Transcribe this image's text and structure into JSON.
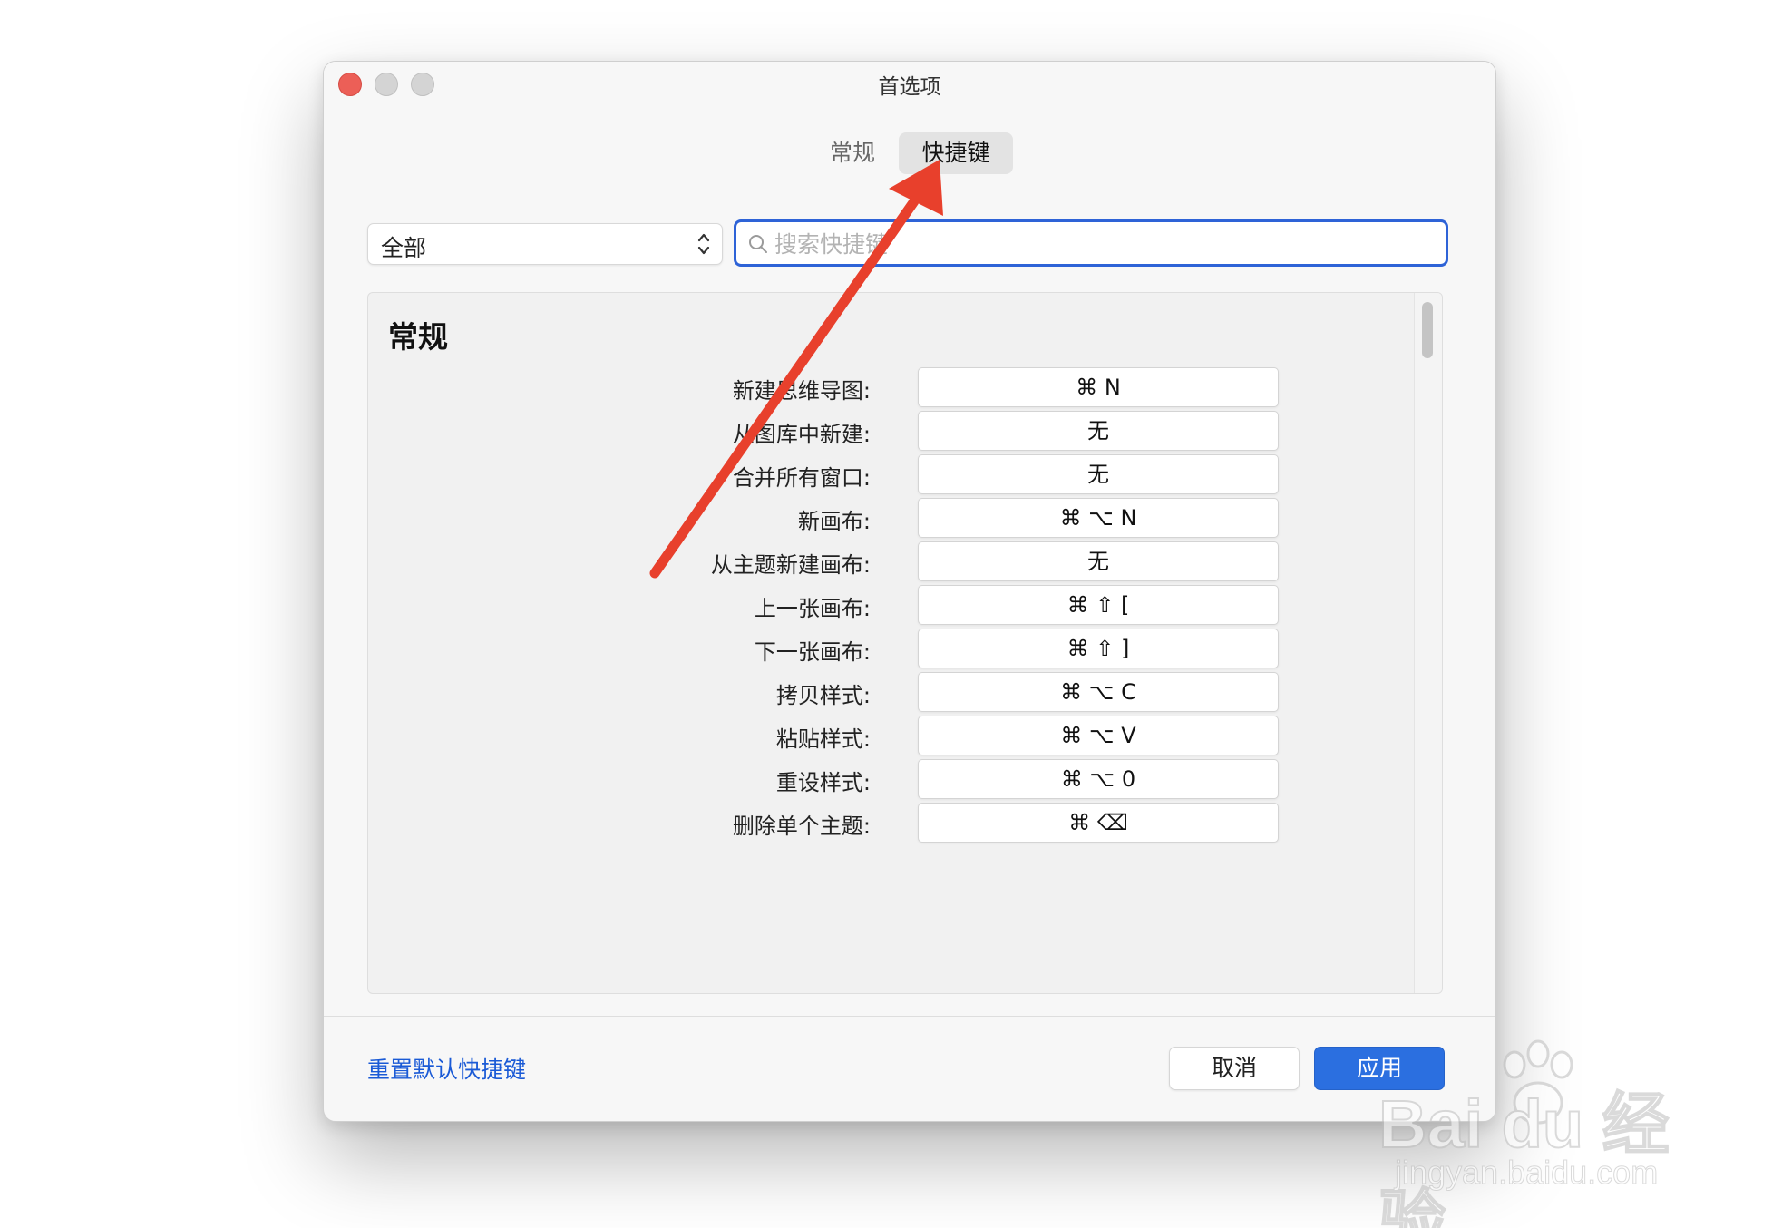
{
  "window": {
    "title": "首选项"
  },
  "tabs": [
    {
      "label": "常规"
    },
    {
      "label": "快捷键"
    }
  ],
  "filter": {
    "selected": "全部"
  },
  "search": {
    "placeholder": "搜索快捷键",
    "value": ""
  },
  "section": {
    "title": "常规",
    "items": [
      {
        "label": "新建思维导图:",
        "shortcut": "⌘ N"
      },
      {
        "label": "从图库中新建:",
        "shortcut": "无"
      },
      {
        "label": "合并所有窗口:",
        "shortcut": "无"
      },
      {
        "label": "新画布:",
        "shortcut": "⌘ ⌥ N"
      },
      {
        "label": "从主题新建画布:",
        "shortcut": "无"
      },
      {
        "label": "上一张画布:",
        "shortcut": "⌘ ⇧ ["
      },
      {
        "label": "下一张画布:",
        "shortcut": "⌘ ⇧ ]"
      },
      {
        "label": "拷贝样式:",
        "shortcut": "⌘ ⌥ C"
      },
      {
        "label": "粘贴样式:",
        "shortcut": "⌘ ⌥ V"
      },
      {
        "label": "重设样式:",
        "shortcut": "⌘ ⌥ 0"
      },
      {
        "label": "删除单个主题:",
        "shortcut": "⌘ ⌫"
      }
    ]
  },
  "footer": {
    "reset_label": "重置默认快捷键",
    "cancel_label": "取消",
    "apply_label": "应用"
  },
  "watermark": {
    "brand": "Bai du 经验",
    "url": "jingyan.baidu.com"
  },
  "colors": {
    "accent": "#2b6fe0",
    "link": "#1a5ad6",
    "annotation_arrow": "#e8402c",
    "close_button": "#ec5f57"
  },
  "icons": [
    "search-icon",
    "updown-chevron-icon",
    "annotation-arrow",
    "baidu-paw-icon"
  ]
}
